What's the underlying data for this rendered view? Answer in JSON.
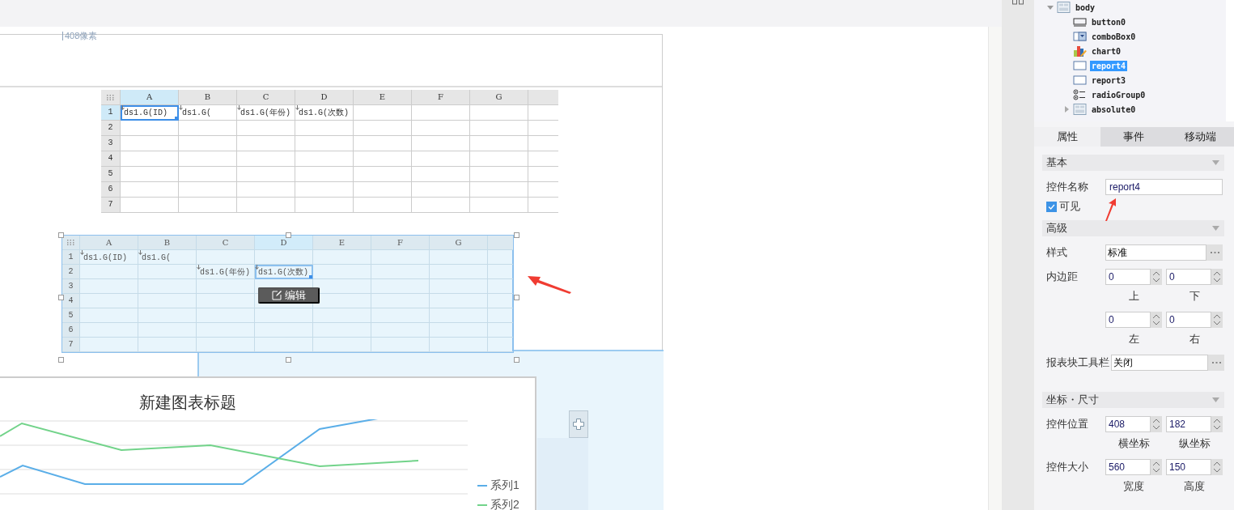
{
  "ruler_label": "408像素",
  "report_grids": [
    {
      "selected": false,
      "columns": [
        "A",
        "B",
        "C",
        "D",
        "E",
        "F",
        "G"
      ],
      "rows": [
        {
          "label": "1",
          "cells": [
            {
              "text": "ds1.G(ID)",
              "selected": true
            },
            {
              "text": "ds1.G(",
              "selected": false
            },
            {
              "text": "ds1.G(年份)",
              "selected": false
            },
            {
              "text": "ds1.G(次数)",
              "selected": false
            }
          ]
        },
        {
          "label": "2"
        },
        {
          "label": "3"
        },
        {
          "label": "4"
        },
        {
          "label": "5"
        },
        {
          "label": "6"
        },
        {
          "label": "7"
        }
      ]
    },
    {
      "selected": true,
      "columns": [
        "A",
        "B",
        "C",
        "D",
        "E",
        "F",
        "G"
      ],
      "rows": [
        {
          "label": "1",
          "cells": [
            {
              "text": "ds1.G(ID)",
              "selected": false
            },
            {
              "text": "ds1.G(",
              "selected": false
            }
          ]
        },
        {
          "label": "2",
          "cells": [
            null,
            null,
            {
              "text": "ds1.G(年份)",
              "selected": false
            },
            {
              "text": "ds1.G(次数)",
              "selected": true
            }
          ]
        },
        {
          "label": "3"
        },
        {
          "label": "4"
        },
        {
          "label": "5"
        },
        {
          "label": "6"
        },
        {
          "label": "7"
        }
      ]
    }
  ],
  "edit_tooltip": {
    "label": "编辑"
  },
  "chart": {
    "title": "新建图表标题",
    "legend": [
      {
        "label": "系列1",
        "color": "#5aaee8"
      },
      {
        "label": "系列2",
        "color": "#72d38a"
      }
    ]
  },
  "component_tree": [
    {
      "label": "body",
      "kind": "layout",
      "expanded": true,
      "selected": false,
      "children": [
        {
          "label": "button0",
          "kind": "button",
          "selected": false
        },
        {
          "label": "comboBox0",
          "kind": "combobox",
          "selected": false
        },
        {
          "label": "chart0",
          "kind": "chart",
          "selected": false
        },
        {
          "label": "report4",
          "kind": "report",
          "selected": true
        },
        {
          "label": "report3",
          "kind": "report",
          "selected": false
        },
        {
          "label": "radioGroup0",
          "kind": "radio",
          "selected": false
        },
        {
          "label": "absolute0",
          "kind": "layout",
          "expanded": false,
          "selected": false
        }
      ]
    }
  ],
  "tabs": [
    {
      "label": "属性",
      "selected": true
    },
    {
      "label": "事件",
      "selected": false
    },
    {
      "label": "移动端",
      "selected": false
    }
  ],
  "sections": [
    {
      "title": "基本",
      "expanded": true,
      "rows": [
        {
          "kind": "text",
          "label": "控件名称",
          "value": "report4"
        },
        {
          "kind": "checkbox",
          "label": "可见",
          "checked": true
        }
      ]
    },
    {
      "title": "高级",
      "expanded": true,
      "rows": [
        {
          "kind": "picker",
          "label": "样式",
          "value": "标准"
        },
        {
          "kind": "spinners",
          "label": "内边距",
          "fields": [
            {
              "value": "0",
              "caption": "上"
            },
            {
              "value": "0",
              "caption": "下"
            },
            {
              "value": "0",
              "caption": "左"
            },
            {
              "value": "0",
              "caption": "右"
            }
          ]
        },
        {
          "kind": "picker",
          "label": "报表块工具栏",
          "value": "关闭"
        }
      ]
    },
    {
      "title": "坐标・尺寸",
      "expanded": true,
      "rows": [
        {
          "kind": "spinners",
          "label": "控件位置",
          "fields": [
            {
              "value": "408",
              "caption": "横坐标"
            },
            {
              "value": "182",
              "caption": "纵坐标"
            }
          ]
        },
        {
          "kind": "spinners",
          "label": "控件大小",
          "fields": [
            {
              "value": "560",
              "caption": "宽度"
            },
            {
              "value": "150",
              "caption": "高度"
            }
          ]
        }
      ]
    }
  ]
}
